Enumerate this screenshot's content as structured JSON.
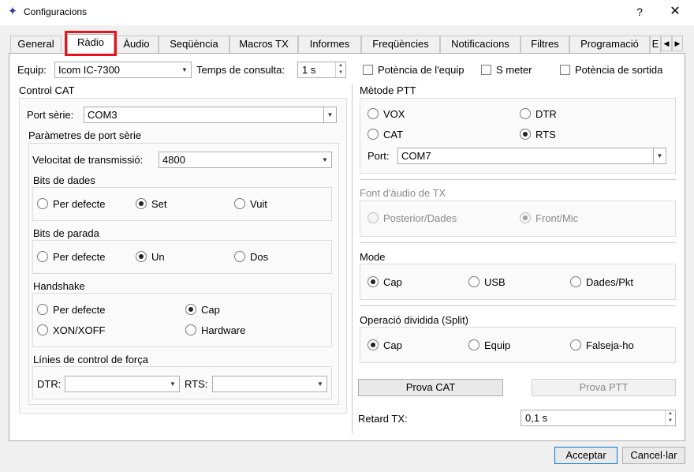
{
  "window": {
    "title": "Configuracions",
    "help": "?",
    "close": "✕",
    "icon": "settings-star-icon"
  },
  "tabs": [
    {
      "label": "General",
      "active": false
    },
    {
      "label": "Ràdio",
      "active": true
    },
    {
      "label": "Àudio",
      "active": false
    },
    {
      "label": "Seqüència",
      "active": false
    },
    {
      "label": "Macros TX",
      "active": false
    },
    {
      "label": "Informes",
      "active": false
    },
    {
      "label": "Freqüències",
      "active": false
    },
    {
      "label": "Notificacions",
      "active": false
    },
    {
      "label": "Filtres",
      "active": false
    },
    {
      "label": "Programació",
      "active": false
    },
    {
      "label": "E",
      "active": false
    }
  ],
  "tab_scroll": {
    "left": "◀",
    "right": "▶"
  },
  "rig": {
    "equip_label": "Equip:",
    "equip_value": "Icom IC-7300",
    "poll_label": "Temps de consulta:",
    "poll_value": "1 s",
    "power_label": "Potència de l'equip",
    "smeter_label": "S meter",
    "output_power_label": "Potència de sortida"
  },
  "cat": {
    "title": "Control CAT",
    "serial_port_label": "Port sèrie:",
    "serial_port_value": "COM3",
    "serial_params_title": "Paràmetres de port sèrie",
    "baud_label": "Velocitat de transmissió:",
    "baud_value": "4800",
    "data_bits": {
      "title": "Bits de dades",
      "options": [
        "Per defecte",
        "Set",
        "Vuit"
      ],
      "selected": 1
    },
    "stop_bits": {
      "title": "Bits de parada",
      "options": [
        "Per defecte",
        "Un",
        "Dos"
      ],
      "selected": 1
    },
    "handshake": {
      "title": "Handshake",
      "options": [
        "Per defecte",
        "Cap",
        "XON/XOFF",
        "Hardware"
      ],
      "selected": 1
    },
    "force_lines": {
      "title": "Línies de control de força",
      "dtr_label": "DTR:",
      "rts_label": "RTS:",
      "dtr_value": "",
      "rts_value": ""
    }
  },
  "ptt": {
    "title": "Mètode PTT",
    "options": [
      "VOX",
      "DTR",
      "CAT",
      "RTS"
    ],
    "selected": 3,
    "port_label": "Port:",
    "port_value": "COM7"
  },
  "tx_audio": {
    "title": "Font d'àudio de TX",
    "options": [
      "Posterior/Dades",
      "Front/Mic"
    ],
    "selected": 1,
    "enabled": false
  },
  "mode": {
    "title": "Mode",
    "options": [
      "Cap",
      "USB",
      "Dades/Pkt"
    ],
    "selected": 0
  },
  "split": {
    "title": "Operació dividida (Split)",
    "options": [
      "Cap",
      "Equip",
      "Falseja-ho"
    ],
    "selected": 0
  },
  "buttons": {
    "test_cat": "Prova CAT",
    "test_ptt": "Prova PTT",
    "ok": "Acceptar",
    "cancel": "Cancel·lar"
  },
  "tx_delay": {
    "label": "Retard TX:",
    "value": "0,1 s"
  },
  "colors": {
    "highlight": "#e8141b",
    "accent": "#0078d7"
  }
}
